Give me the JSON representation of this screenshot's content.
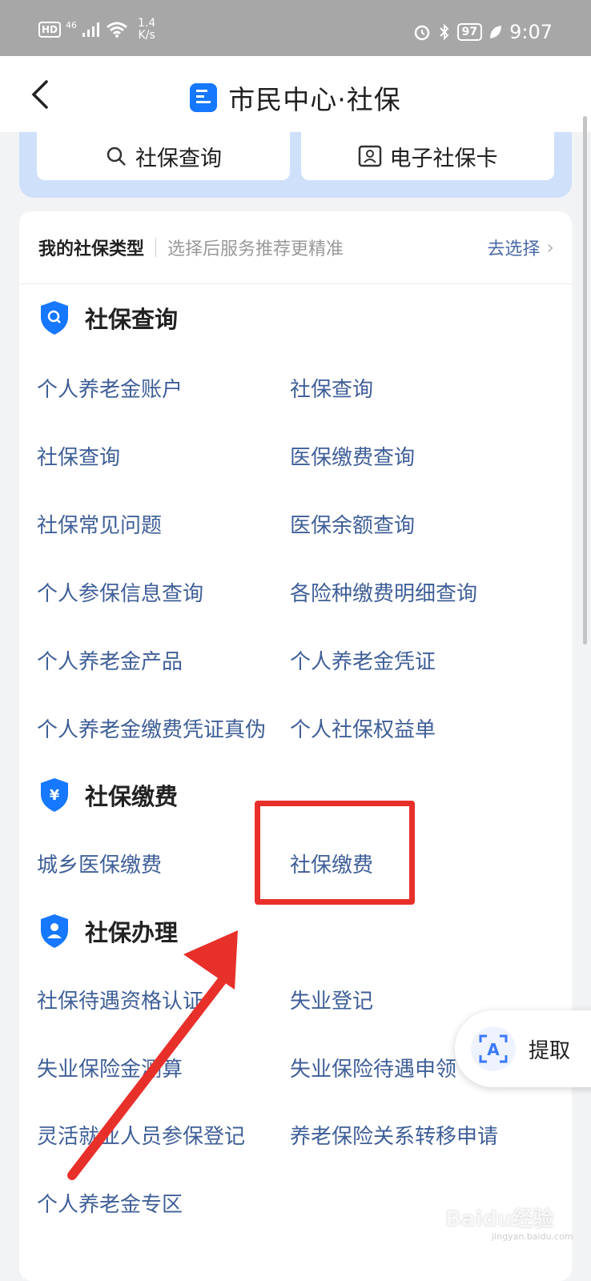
{
  "status_bar": {
    "hd": "HD",
    "network": "46",
    "speed_value": "1.4",
    "speed_unit": "K/s",
    "battery": "97",
    "time": "9:07"
  },
  "header": {
    "title": "市民中心·社保",
    "back_icon": "chevron-left-icon"
  },
  "top_buttons": {
    "search_label": "社保查询",
    "card_label": "电子社保卡"
  },
  "social_type": {
    "label": "我的社保类型",
    "hint": "选择后服务推荐更精准",
    "action": "去选择"
  },
  "sections": [
    {
      "title": "社保查询",
      "icon": "search-shield-icon",
      "items": [
        "个人养老金账户",
        "社保查询",
        "社保查询",
        "医保缴费查询",
        "社保常见问题",
        "医保余额查询",
        "个人参保信息查询",
        "各险种缴费明细查询",
        "个人养老金产品",
        "个人养老金凭证",
        "个人养老金缴费凭证真伪",
        "个人社保权益单"
      ]
    },
    {
      "title": "社保缴费",
      "icon": "yen-shield-icon",
      "items": [
        "城乡医保缴费",
        "社保缴费"
      ]
    },
    {
      "title": "社保办理",
      "icon": "person-shield-icon",
      "items": [
        "社保待遇资格认证",
        "失业登记",
        "失业保险金测算",
        "失业保险待遇申领",
        "灵活就业人员参保登记",
        "养老保险关系转移申请",
        "个人养老金专区"
      ]
    }
  ],
  "floating": {
    "label": "提取"
  },
  "watermark": {
    "text": "Baidu经验",
    "sub": "jingyan.baidu.com"
  },
  "colors": {
    "accent": "#1677ff",
    "link": "#3f5f98",
    "highlight": "#e8302a",
    "strip": "#cfe0fb"
  }
}
